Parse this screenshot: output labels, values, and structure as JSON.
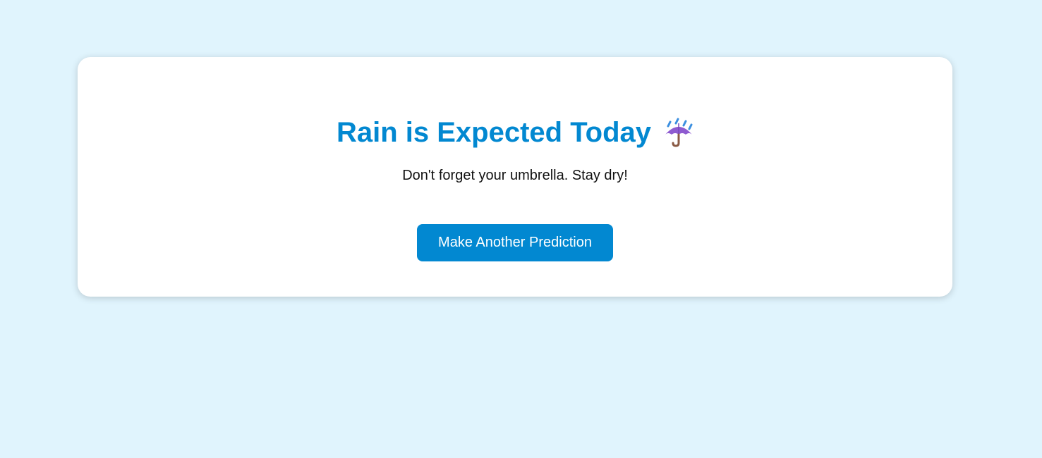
{
  "result": {
    "title": "Rain is Expected Today",
    "icon": "umbrella-with-rain-icon",
    "message": "Don't forget your umbrella. Stay dry!",
    "button_label": "Make Another Prediction"
  },
  "colors": {
    "background": "#e0f4fd",
    "card": "#ffffff",
    "accent": "#0288d1",
    "button_text": "#ffffff",
    "umbrella_canopy": "#8e5bd0",
    "umbrella_handle": "#8a5a44",
    "rain_drops": "#3b8fe0"
  }
}
